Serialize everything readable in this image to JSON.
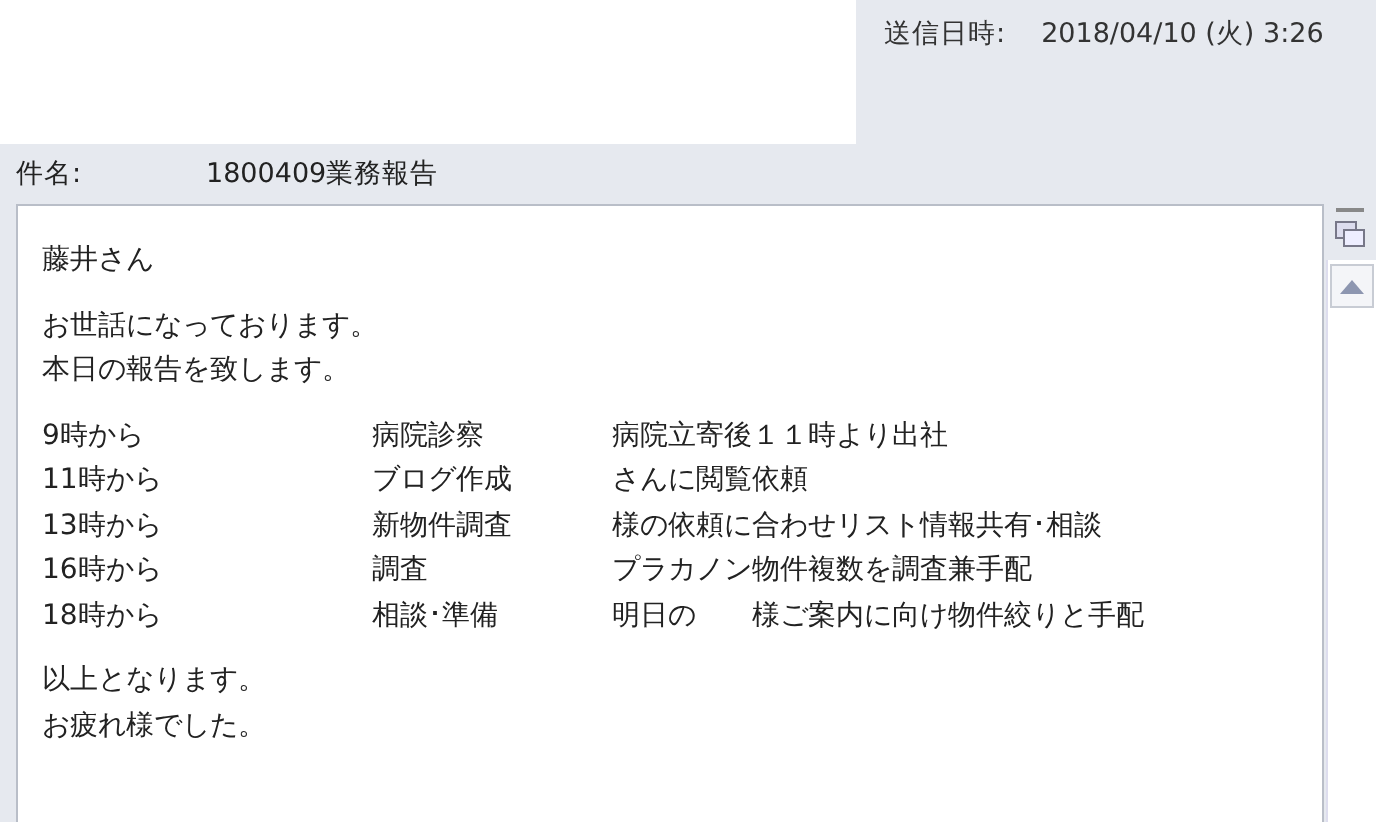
{
  "header": {
    "sent_label": "送信日時:",
    "sent_value": "2018/04/10 (火) 3:26"
  },
  "subject": {
    "label": "件名:",
    "value": "1800409業務報告"
  },
  "body": {
    "greeting": "藤井さん",
    "intro": [
      "お世話になっております。",
      "本日の報告を致します。"
    ],
    "schedule": [
      {
        "time": "9時から",
        "task": "病院診察",
        "detail": "病院立寄後１１時より出社"
      },
      {
        "time": "11時から",
        "task": "ブログ作成",
        "detail": "さんに閲覧依頼"
      },
      {
        "time": "13時から",
        "task": "新物件調査",
        "detail": "様の依頼に合わせリスト情報共有･相談"
      },
      {
        "time": "16時から",
        "task": "調査",
        "detail": "プラカノン物件複数を調査兼手配"
      },
      {
        "time": "18時から",
        "task": "相談･準備",
        "detail": "明日の　　様ご案内に向け物件絞りと手配"
      }
    ],
    "closing": [
      "以上となります。",
      "お疲れ様でした。"
    ]
  }
}
